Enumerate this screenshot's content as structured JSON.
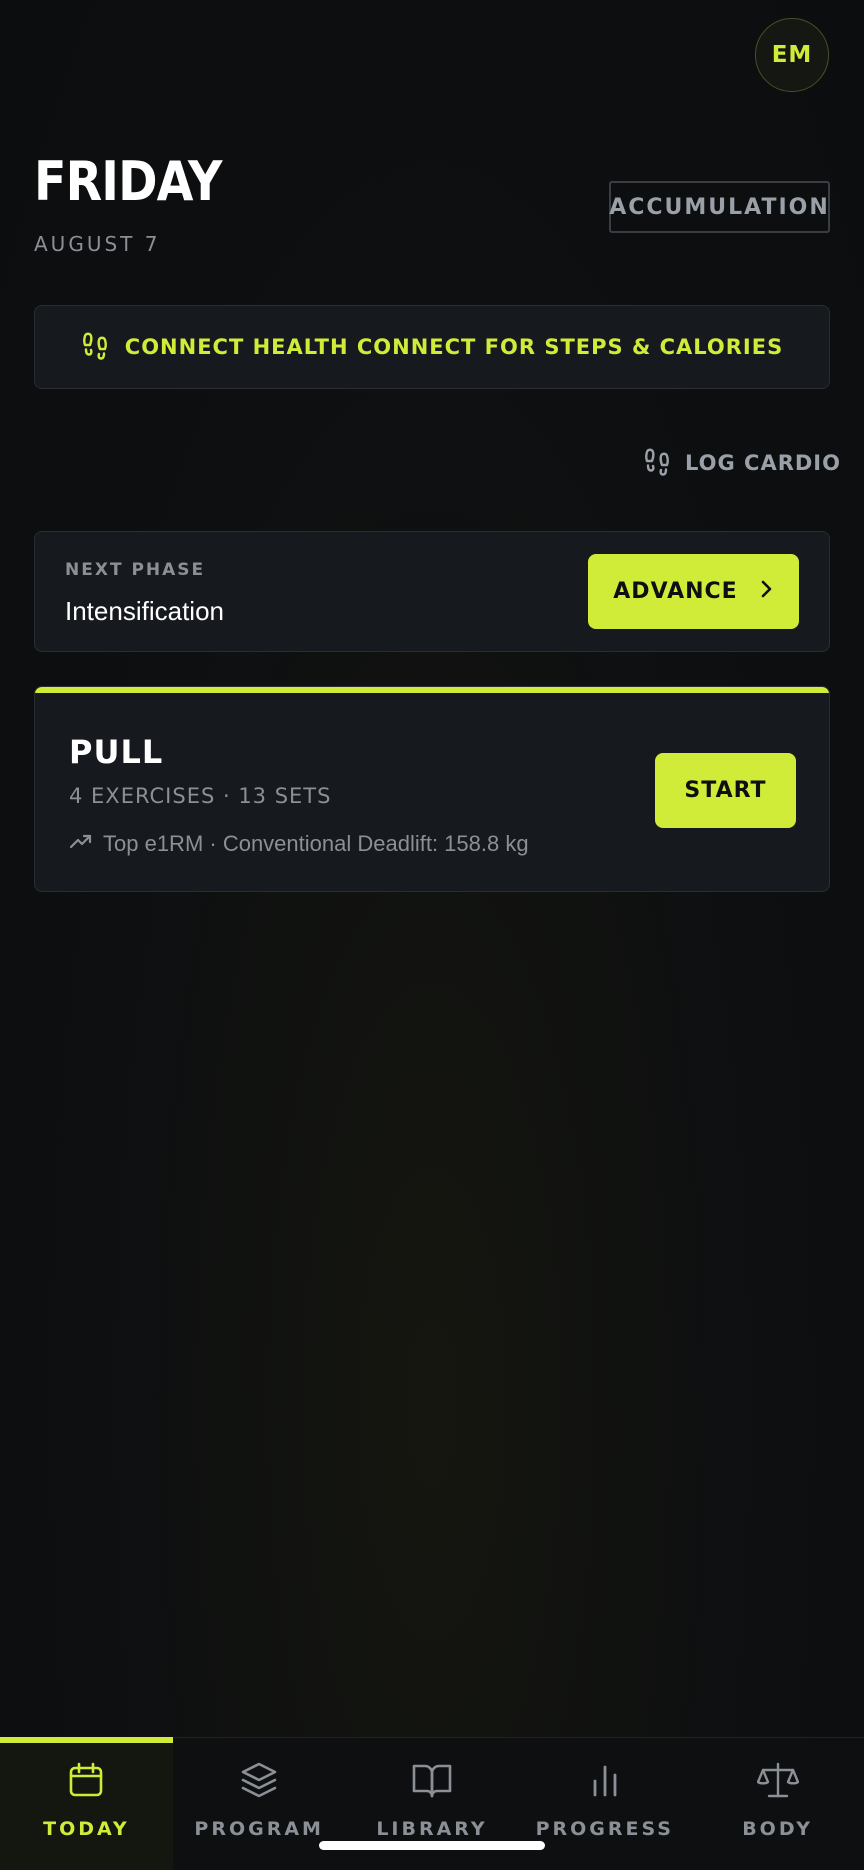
{
  "header": {
    "avatar_initials": "EM",
    "day": "FRIDAY",
    "date": "AUGUST 7",
    "phase_badge": "ACCUMULATION"
  },
  "health_banner": {
    "icon": "footprints-icon",
    "label": "CONNECT HEALTH CONNECT FOR STEPS & CALORIES"
  },
  "log_cardio": {
    "icon": "footprints-icon",
    "label": "LOG CARDIO"
  },
  "next_phase": {
    "label": "NEXT PHASE",
    "name": "Intensification",
    "button_label": "ADVANCE"
  },
  "workout": {
    "title": "PULL",
    "meta": "4 EXERCISES · 13 SETS",
    "pr_text": "Top e1RM · Conventional Deadlift: 158.8 kg",
    "button_label": "START"
  },
  "nav": {
    "items": [
      {
        "label": "TODAY",
        "icon": "calendar-icon",
        "active": true
      },
      {
        "label": "PROGRAM",
        "icon": "layers-icon",
        "active": false
      },
      {
        "label": "LIBRARY",
        "icon": "book-icon",
        "active": false
      },
      {
        "label": "PROGRESS",
        "icon": "bar-chart-icon",
        "active": false
      },
      {
        "label": "BODY",
        "icon": "scale-icon",
        "active": false
      }
    ]
  },
  "colors": {
    "accent": "#d0ec39",
    "background": "#0d0f11",
    "card": "#16191d",
    "muted_text": "#8b9097"
  }
}
